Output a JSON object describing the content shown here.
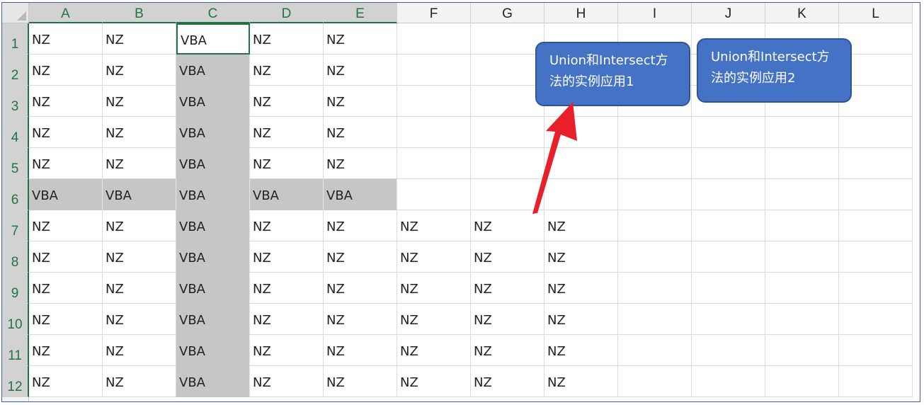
{
  "sheet": {
    "columns": [
      "A",
      "B",
      "C",
      "D",
      "E",
      "F",
      "G",
      "H",
      "I",
      "J",
      "K",
      "L"
    ],
    "rows": [
      "1",
      "2",
      "3",
      "4",
      "5",
      "6",
      "7",
      "8",
      "9",
      "10",
      "11",
      "12"
    ],
    "cells": [
      [
        "NZ",
        "NZ",
        "VBA",
        "NZ",
        "NZ",
        "",
        "",
        "",
        "",
        "",
        "",
        ""
      ],
      [
        "NZ",
        "NZ",
        "VBA",
        "NZ",
        "NZ",
        "",
        "",
        "",
        "",
        "",
        "",
        ""
      ],
      [
        "NZ",
        "NZ",
        "VBA",
        "NZ",
        "NZ",
        "",
        "",
        "",
        "",
        "",
        "",
        ""
      ],
      [
        "NZ",
        "NZ",
        "VBA",
        "NZ",
        "NZ",
        "",
        "",
        "",
        "",
        "",
        "",
        ""
      ],
      [
        "NZ",
        "NZ",
        "VBA",
        "NZ",
        "NZ",
        "",
        "",
        "",
        "",
        "",
        "",
        ""
      ],
      [
        "VBA",
        "VBA",
        "VBA",
        "VBA",
        "VBA",
        "",
        "",
        "",
        "",
        "",
        "",
        ""
      ],
      [
        "NZ",
        "NZ",
        "VBA",
        "NZ",
        "NZ",
        "NZ",
        "NZ",
        "NZ",
        "",
        "",
        "",
        ""
      ],
      [
        "NZ",
        "NZ",
        "VBA",
        "NZ",
        "NZ",
        "NZ",
        "NZ",
        "NZ",
        "",
        "",
        "",
        ""
      ],
      [
        "NZ",
        "NZ",
        "VBA",
        "NZ",
        "NZ",
        "NZ",
        "NZ",
        "NZ",
        "",
        "",
        "",
        ""
      ],
      [
        "NZ",
        "NZ",
        "VBA",
        "NZ",
        "NZ",
        "NZ",
        "NZ",
        "NZ",
        "",
        "",
        "",
        ""
      ],
      [
        "NZ",
        "NZ",
        "VBA",
        "NZ",
        "NZ",
        "NZ",
        "NZ",
        "NZ",
        "",
        "",
        "",
        ""
      ],
      [
        "NZ",
        "NZ",
        "VBA",
        "NZ",
        "NZ",
        "NZ",
        "NZ",
        "NZ",
        "",
        "",
        "",
        ""
      ]
    ],
    "selected_range": "A1:E12",
    "active_cell": "C1"
  },
  "buttons": {
    "button1_label": "Union和Intersect方法的实例应用1",
    "button2_label": "Union和Intersect方法的实例应用2"
  },
  "colors": {
    "selection_accent": "#217346",
    "highlight_fill": "#c6c6c6",
    "button_fill": "#4472c4",
    "arrow": "#e8202a"
  }
}
